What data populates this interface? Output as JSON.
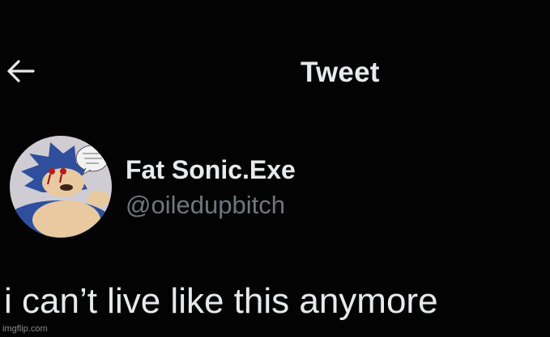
{
  "header": {
    "back_icon": "arrow-left-icon",
    "title": "Tweet"
  },
  "author": {
    "avatar_icon": "profile-picture",
    "display_name": "Fat Sonic.Exe",
    "handle": "@oiledupbitch"
  },
  "tweet": {
    "text": "i can’t live like this anymore"
  },
  "watermark": "imgflip.com",
  "colors": {
    "background": "#000000",
    "primary_text": "#e7e9ea",
    "secondary_text": "#71767b",
    "avatar_background": "#cfcdd3",
    "character_blue": "#2f4f9e"
  }
}
